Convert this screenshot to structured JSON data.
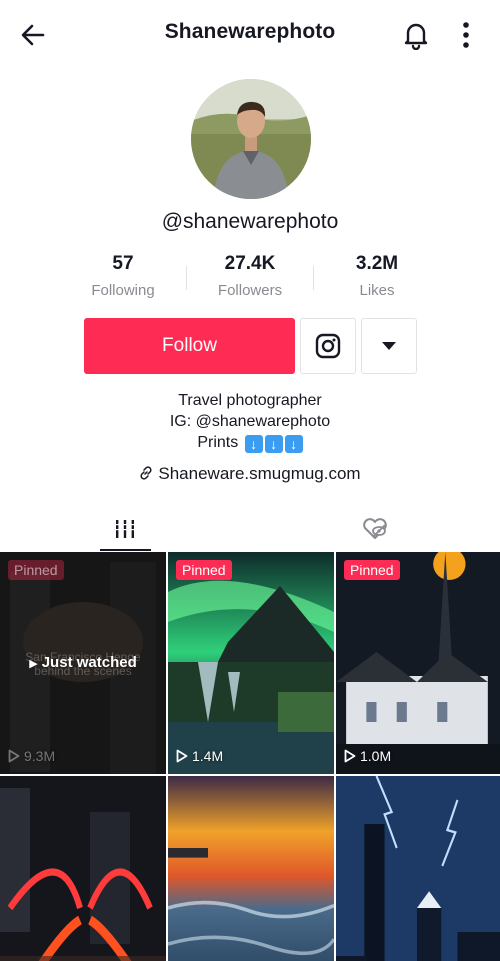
{
  "header": {
    "title": "Shanewarephoto"
  },
  "profile": {
    "username": "@shanewarephoto",
    "stats": [
      {
        "value": "57",
        "label": "Following"
      },
      {
        "value": "27.4K",
        "label": "Followers"
      },
      {
        "value": "3.2M",
        "label": "Likes"
      }
    ],
    "follow_label": "Follow",
    "bio": {
      "line1": "Travel photographer",
      "line2": "IG: @shanewarephoto",
      "line3": "Prints"
    },
    "link": "Shaneware.smugmug.com"
  },
  "colors": {
    "accent": "#fe2c55",
    "text": "#161823",
    "muted": "#8a8b91"
  },
  "icons": {
    "back": "back-arrow-icon",
    "bell": "bell-icon",
    "more": "more-vertical-icon",
    "instagram": "instagram-icon",
    "dropdown": "triangle-down-icon",
    "link": "link-icon",
    "videos_tab": "grid-icon",
    "liked_tab": "hidden-heart-icon"
  },
  "videos": [
    {
      "pinned": "Pinned",
      "views": "9.3M",
      "overlay": "Just watched",
      "caption_line1": "San Francisco Henge",
      "caption_line2": "behind the scenes"
    },
    {
      "pinned": "Pinned",
      "views": "1.4M"
    },
    {
      "pinned": "Pinned",
      "views": "1.0M"
    },
    {},
    {},
    {}
  ]
}
